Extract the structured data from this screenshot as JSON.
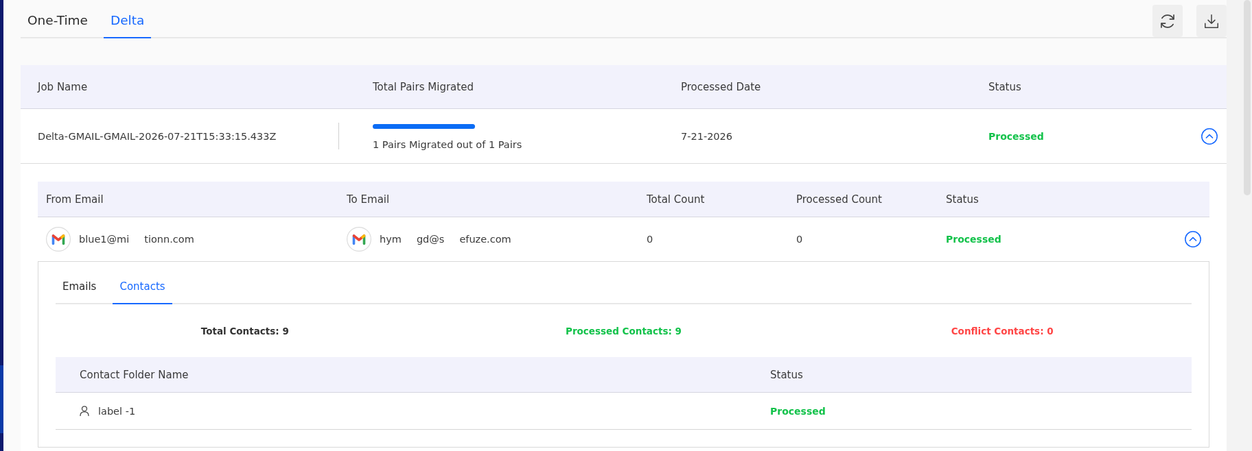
{
  "tabs": [
    {
      "label": "One-Time",
      "selected": false
    },
    {
      "label": "Delta",
      "selected": true
    }
  ],
  "jobs_table": {
    "columns": [
      "Job Name",
      "Total Pairs Migrated",
      "Processed Date",
      "Status"
    ],
    "rows": [
      {
        "job_name": "Delta-GMAIL-GMAIL-2026-07-21T15:33:15.433Z",
        "progress": {
          "level": 1,
          "label": "1 Pairs Migrated out of 1 Pairs"
        },
        "processed_date": "7-21-2026",
        "status": "Processed",
        "expanded": true,
        "pairs_table": {
          "columns": [
            "From Email",
            "To Email",
            "Total Count",
            "Processed Count",
            "Status"
          ],
          "rows": [
            {
              "from_email": {
                "visible_parts": [
                  "blue1@mi",
                  "tionn.com"
                ]
              },
              "to_email": {
                "visible_parts": [
                  "hym",
                  "gd@s",
                  "efuze.com"
                ]
              },
              "total_count": "0",
              "processed_count": "0",
              "status": "Processed",
              "expanded": true,
              "detail": {
                "tabs": [
                  {
                    "label": "Emails",
                    "selected": false
                  },
                  {
                    "label": "Contacts",
                    "selected": true
                  }
                ],
                "summary": [
                  {
                    "label": "Total Contacts: 9",
                    "color": "#333333"
                  },
                  {
                    "label": "Processed Contacts: 9",
                    "color": "#12c24a"
                  },
                  {
                    "label": "Conflict Contacts: 0",
                    "color": "#ff4545"
                  }
                ],
                "folders_table": {
                  "columns": [
                    "Contact Folder Name",
                    "Status"
                  ],
                  "rows": [
                    {
                      "name": "label -1",
                      "status": "Processed"
                    }
                  ]
                }
              }
            }
          ]
        }
      }
    ]
  }
}
